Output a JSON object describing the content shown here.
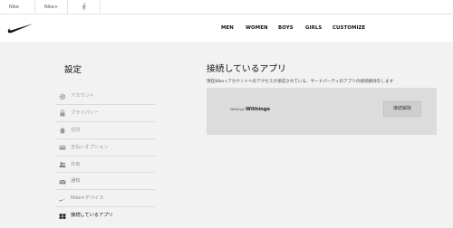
{
  "topbar": {
    "tabs": [
      {
        "label": "Nike"
      },
      {
        "label": "Nike+"
      },
      {
        "label": "",
        "icon": "jordan-jumpman-icon"
      }
    ]
  },
  "header": {
    "logo_icon": "nike-swoosh-icon",
    "nav": [
      {
        "label": "MEN"
      },
      {
        "label": "WOMEN"
      },
      {
        "label": "BOYS"
      },
      {
        "label": "GIRLS"
      },
      {
        "label": "CUSTOMIZE"
      }
    ]
  },
  "sidebar": {
    "title": "設定",
    "items": [
      {
        "label": "アカウント",
        "icon": "gear-icon"
      },
      {
        "label": "プライバシー",
        "icon": "lock-icon"
      },
      {
        "label": "住所",
        "icon": "home-icon"
      },
      {
        "label": "支払いオプション",
        "icon": "credit-card-icon"
      },
      {
        "label": "共有",
        "icon": "people-icon"
      },
      {
        "label": "通知",
        "icon": "envelope-icon"
      },
      {
        "label": "Nike+デバイス",
        "icon": "swoosh-device-icon"
      },
      {
        "label": "接続しているアプリ",
        "icon": "grid-icon",
        "active": true
      }
    ]
  },
  "main": {
    "title": "接続しているアプリ",
    "description": "現在Nike+アカウントへのアクセスが承認されている、サードパーティのアプリの接続解除をします",
    "apps": [
      {
        "logo_text": "Withings",
        "name": "Withings",
        "action_label": "接続解除"
      }
    ]
  },
  "colors": {
    "content_background": "#f2f2f2",
    "app_panel_background": "#dcdcdc",
    "button_background": "#cfcfcf"
  }
}
